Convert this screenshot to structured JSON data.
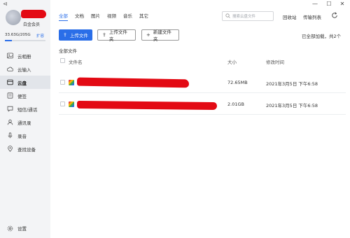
{
  "window": {
    "back": "⊲",
    "minimize": "—",
    "maximize": "☐",
    "close": "✕"
  },
  "profile": {
    "member_label": "白金会员",
    "storage_text": "33.63G/205G",
    "expand_label": "扩容",
    "storage_used_fraction": 0.164
  },
  "sidebar": {
    "items": [
      {
        "label": "云相册",
        "icon": "photo-album-icon",
        "active": false
      },
      {
        "label": "云输入",
        "icon": "cloud-input-icon",
        "active": false
      },
      {
        "label": "云盘",
        "icon": "cloud-drive-icon",
        "active": true
      },
      {
        "label": "便签",
        "icon": "notes-icon",
        "active": false
      },
      {
        "label": "短信/通话",
        "icon": "message-icon",
        "active": false
      },
      {
        "label": "通讯录",
        "icon": "contacts-icon",
        "active": false
      },
      {
        "label": "录音",
        "icon": "microphone-icon",
        "active": false
      },
      {
        "label": "查找设备",
        "icon": "location-pin-icon",
        "active": false
      }
    ],
    "settings_label": "设置"
  },
  "tabs": [
    {
      "label": "全部",
      "active": true
    },
    {
      "label": "文档",
      "active": false
    },
    {
      "label": "图片",
      "active": false
    },
    {
      "label": "视频",
      "active": false
    },
    {
      "label": "音乐",
      "active": false
    },
    {
      "label": "其它",
      "active": false
    }
  ],
  "search": {
    "placeholder": "搜索云盘文件"
  },
  "header_actions": {
    "recycle_bin": "回收站",
    "transfer_list": "传输列表"
  },
  "toolbar": {
    "upload_file": "上传文件",
    "upload_folder": "上传文件夹",
    "new_folder": "新建文件夹",
    "loaded_status": "已全部加载，共2个"
  },
  "section_title": "全部文件",
  "table": {
    "columns": {
      "name": "文件名",
      "size": "大小",
      "modified": "修改时间"
    },
    "rows": [
      {
        "size": "72.65MB",
        "modified": "2021年3月5日 下午6:58"
      },
      {
        "size": "2.01GB",
        "modified": "2021年3月5日 下午6:58"
      }
    ]
  },
  "colors": {
    "accent": "#2a6ee8",
    "sidebar_bg": "#f3f4f6",
    "redaction": "#e30a14"
  }
}
